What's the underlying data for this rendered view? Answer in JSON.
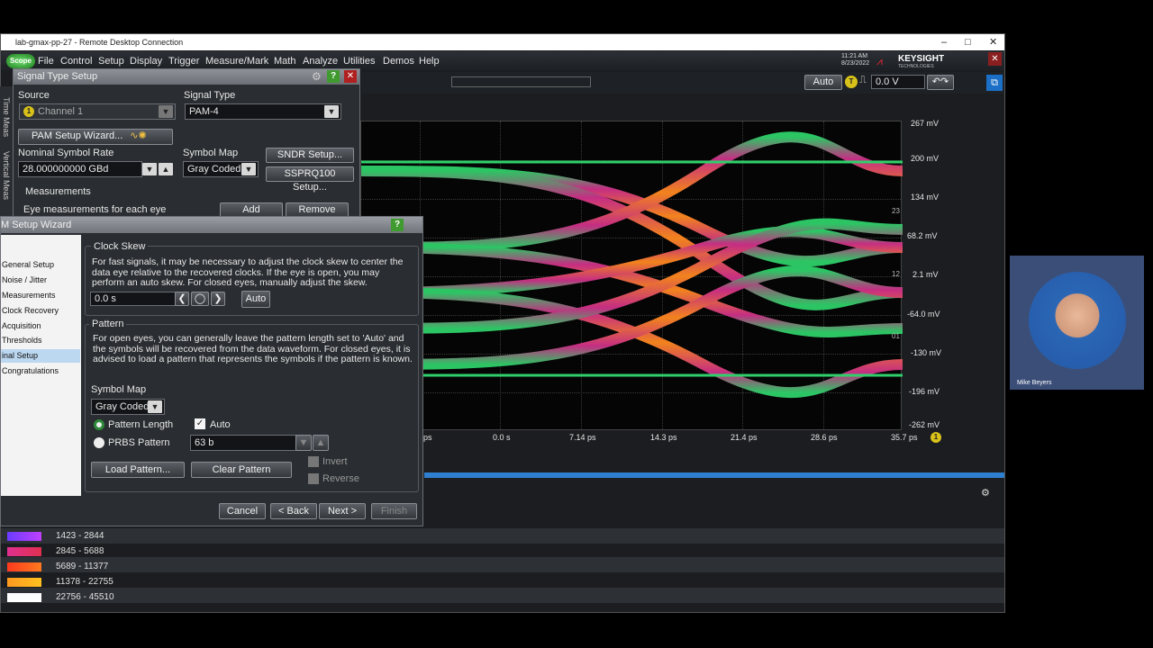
{
  "window": {
    "title": "lab-gmax-pp-27 - Remote Desktop Connection",
    "min": "–",
    "max": "□",
    "close": "✕"
  },
  "menu": {
    "scope_badge": "Scope",
    "items": [
      "File",
      "Control",
      "Setup",
      "Display",
      "Trigger",
      "Measure/Mark",
      "Math",
      "Analyze",
      "Utilities",
      "Demos",
      "Help"
    ],
    "time": "11:21 AM",
    "date": "8/23/2022",
    "brand": "KEYSIGHT",
    "brand_sub": "TECHNOLOGIES"
  },
  "toolbar": {
    "auto_label": "Auto",
    "trigger_badge": "T",
    "trigger_level": "0.0 V"
  },
  "eye": {
    "y_labels": [
      "267 mV",
      "200 mV",
      "134 mV",
      "68.2 mV",
      "2.1 mV",
      "-64.0 mV",
      "-130 mV",
      "-196 mV",
      "-262 mV"
    ],
    "x_labels": [
      "ps",
      "0.0 s",
      "7.14 ps",
      "14.3 ps",
      "21.4 ps",
      "28.6 ps",
      "35.7 ps"
    ],
    "markers": [
      "23",
      "12",
      "01"
    ],
    "channel_badge": "1"
  },
  "signal_setup": {
    "title": "Signal Type Setup",
    "source_label": "Source",
    "source_value": "Channel 1",
    "source_badge": "1",
    "signal_type_label": "Signal Type",
    "signal_type_value": "PAM-4",
    "pam_wizard_button": "PAM Setup Wizard...",
    "symbol_rate_label": "Nominal Symbol Rate",
    "symbol_rate_value": "28.000000000 GBd",
    "symbol_map_label": "Symbol Map",
    "symbol_map_value": "Gray Coded",
    "sndr_button": "SNDR Setup...",
    "ssprq_button": "SSPRQ100 Setup...",
    "measurements_label": "Measurements",
    "eye_meas_label": "Eye measurements for each eye",
    "add_button": "Add",
    "remove_button": "Remove"
  },
  "side_tabs": {
    "tab1": "Time Meas",
    "tab2": "Vertical Meas"
  },
  "wizard": {
    "title": "M Setup Wizard",
    "nav": [
      "General Setup",
      "Noise / Jitter",
      "Measurements",
      "Clock Recovery",
      "Acquisition",
      "Thresholds",
      "inal Setup",
      "Congratulations"
    ],
    "selected_index": 6,
    "clock_skew_title": "Clock Skew",
    "clock_skew_text": "For fast signals, it may be necessary to adjust the clock skew to center the data eye relative to the recovered clocks. If the eye is open, you may perform an auto skew. For closed eyes, manually adjust the skew.",
    "skew_value": "0.0 s",
    "auto_button": "Auto",
    "pattern_title": "Pattern",
    "pattern_text": "For open eyes, you can generally leave the pattern length set to 'Auto' and the symbols will be recovered from the data waveform. For closed eyes, it is advised to load a pattern that represents the symbols if the pattern is known.",
    "symbol_map_label": "Symbol Map",
    "symbol_map_value": "Gray Coded",
    "pattern_length_label": "Pattern Length",
    "auto_check_label": "Auto",
    "prbs_label": "PRBS Pattern",
    "prbs_value": "63 b",
    "load_button": "Load Pattern...",
    "clear_button": "Clear Pattern",
    "invert_label": "Invert",
    "reverse_label": "Reverse",
    "cancel": "Cancel",
    "back": "< Back",
    "next": "Next >",
    "finish": "Finish"
  },
  "legend": [
    {
      "range": "1423 - 2844",
      "color": "#6a3cff"
    },
    {
      "range": "2845 - 5688",
      "color": "#e0307a"
    },
    {
      "range": "5689 - 11377",
      "color": "#ff5a1e"
    },
    {
      "range": "11378 - 22755",
      "color": "#ffb020"
    },
    {
      "range": "22756 - 45510",
      "color": "#ffffff"
    }
  ],
  "webcam": {
    "name": "Mike Beyers"
  }
}
